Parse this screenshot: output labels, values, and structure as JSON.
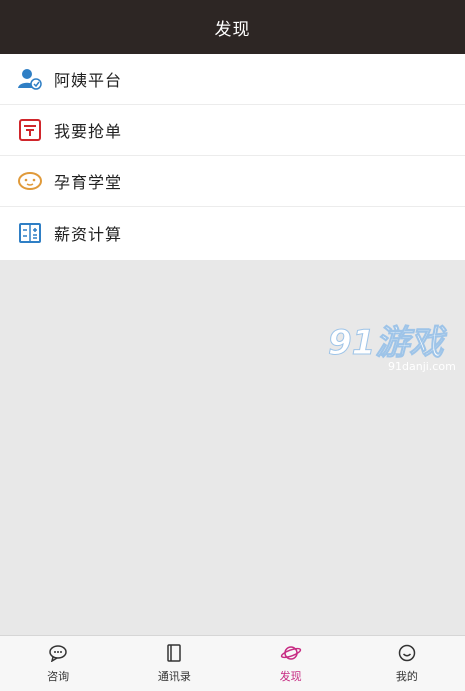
{
  "header": {
    "title": "发现"
  },
  "menu": {
    "items": [
      {
        "label": "阿姨平台",
        "icon": "user-platform-icon",
        "color": "#2f7fc5"
      },
      {
        "label": "我要抢单",
        "icon": "order-icon",
        "color": "#d0262b"
      },
      {
        "label": "孕育学堂",
        "icon": "baby-face-icon",
        "color": "#e09a3a"
      },
      {
        "label": "薪资计算",
        "icon": "calculator-icon",
        "color": "#2f7fc5"
      }
    ]
  },
  "watermark": {
    "brand": "91游戏",
    "site": "91danji.com"
  },
  "tabbar": {
    "items": [
      {
        "label": "咨询",
        "icon": "chat-icon",
        "active": false
      },
      {
        "label": "通讯录",
        "icon": "contacts-icon",
        "active": false
      },
      {
        "label": "发现",
        "icon": "planet-icon",
        "active": true
      },
      {
        "label": "我的",
        "icon": "smiley-icon",
        "active": false
      }
    ],
    "active_color": "#c72c83"
  }
}
